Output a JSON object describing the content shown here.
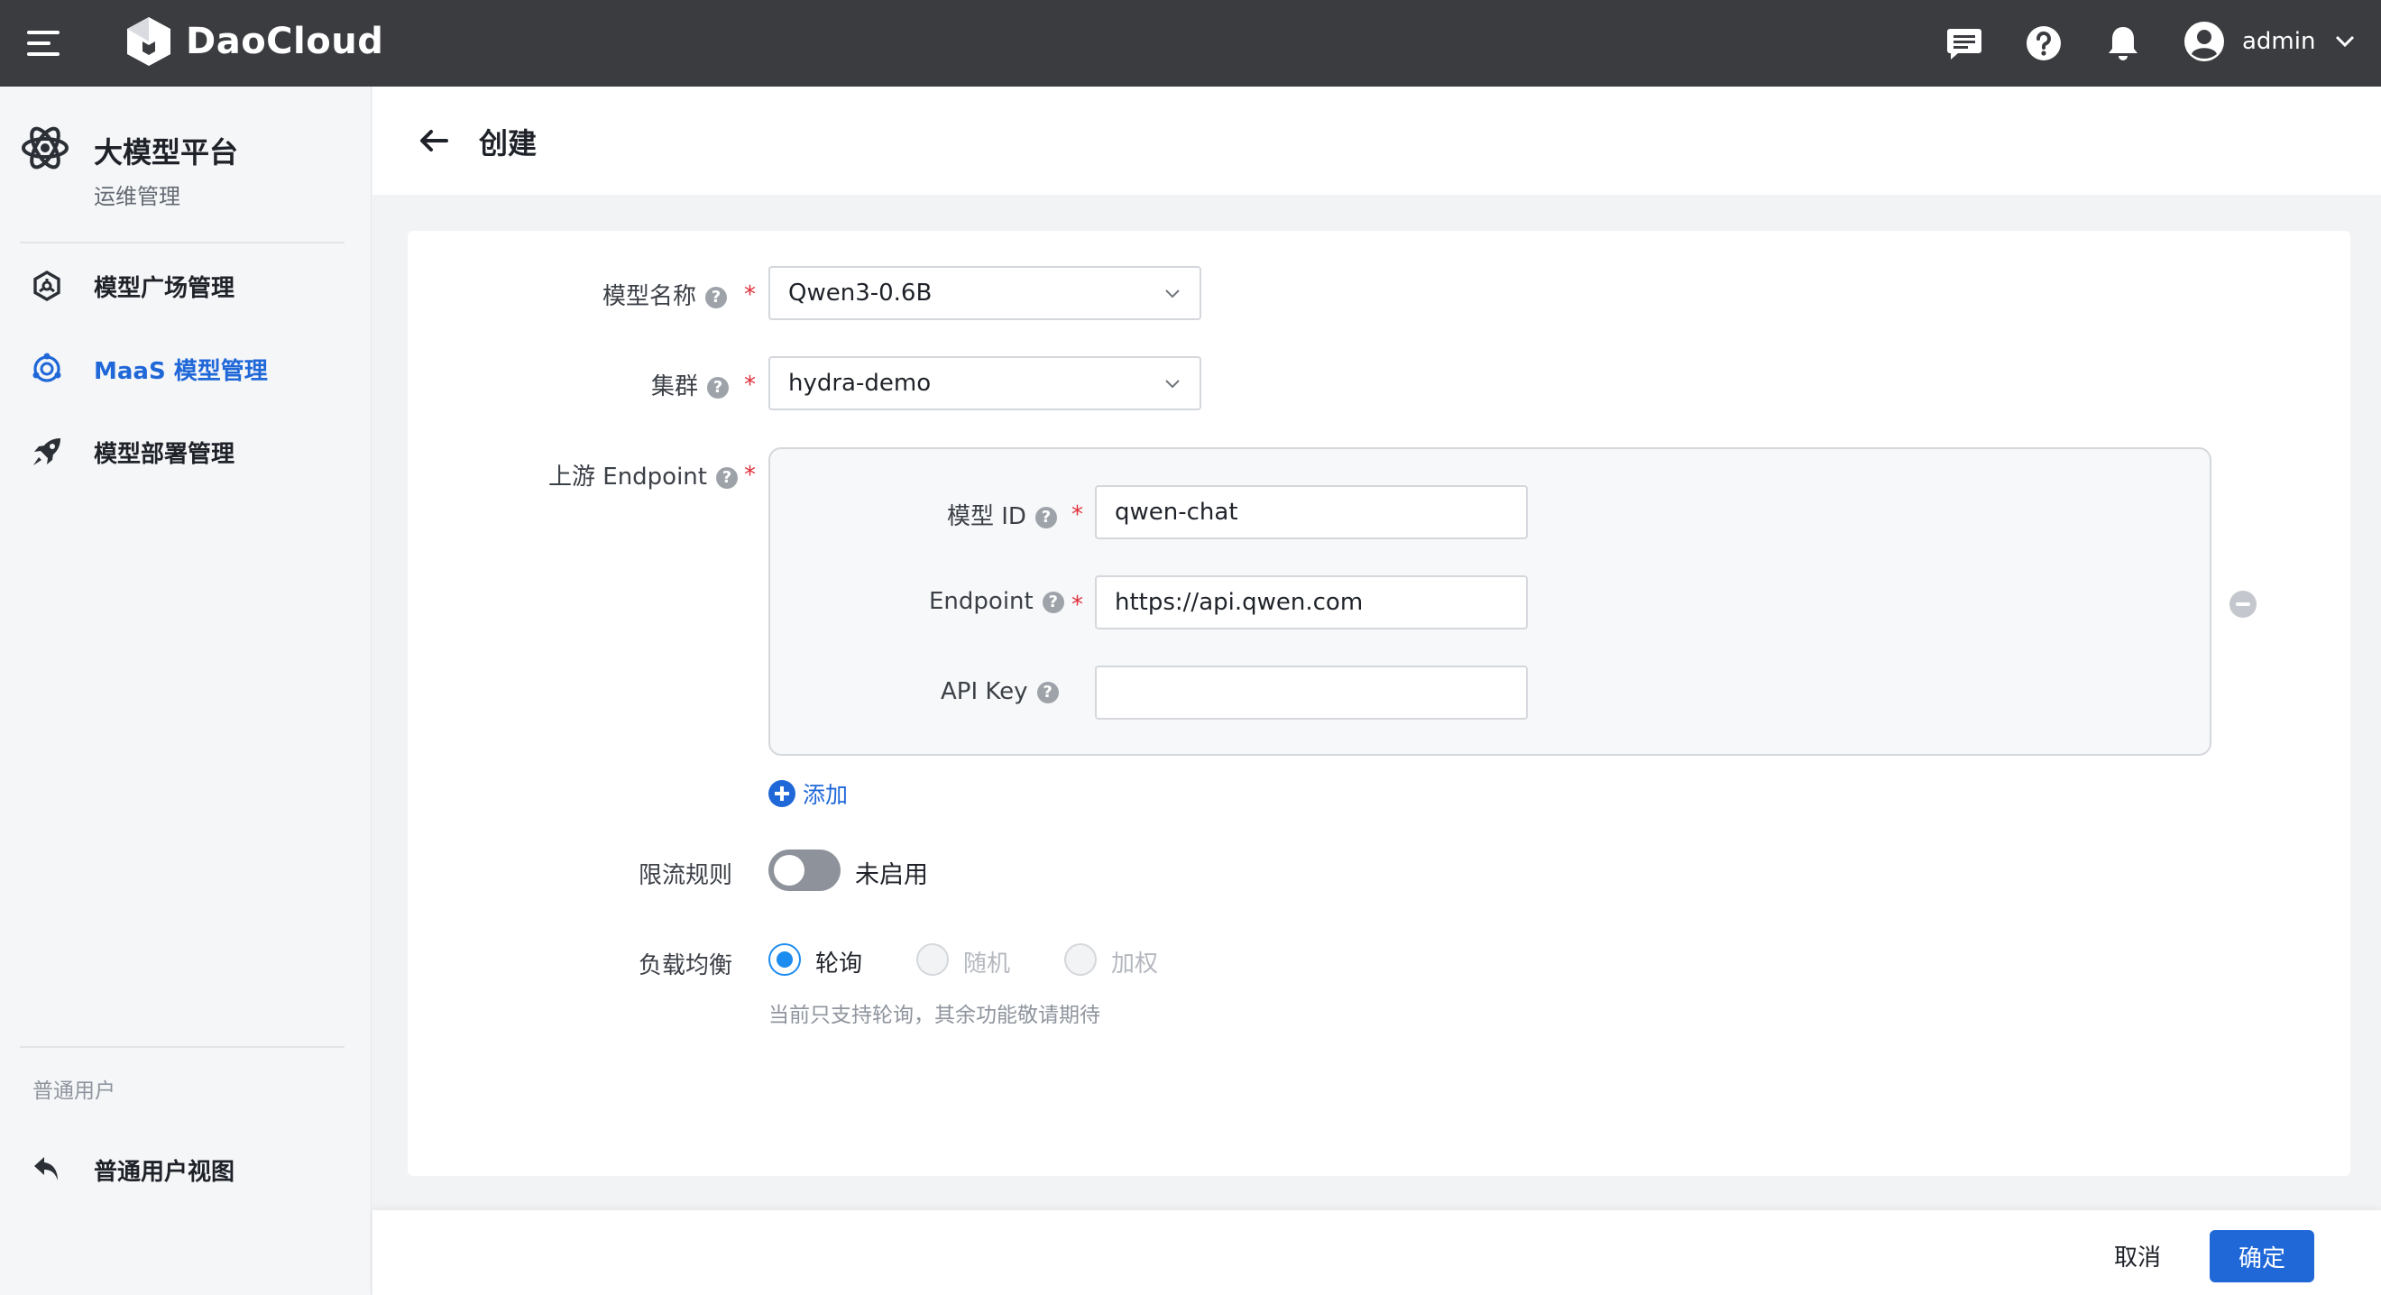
{
  "app": {
    "brand": "DaoCloud",
    "user": "admin",
    "colors": {
      "topbar": "#3a3c40",
      "accent": "#2068d8",
      "required": "#e0303b",
      "radio": "#1d8cf0"
    }
  },
  "topbar": {
    "icons": [
      "menu-icon",
      "daocloud-logo",
      "message-icon",
      "help-icon",
      "bell-icon",
      "user-avatar-icon",
      "chevron-down-icon"
    ]
  },
  "sidebar": {
    "platform_title": "大模型平台",
    "platform_subtitle": "运维管理",
    "items": [
      {
        "label": "模型广场管理",
        "icon": "model-plaza-icon",
        "active": false
      },
      {
        "label": "MaaS 模型管理",
        "icon": "maas-icon",
        "active": true
      },
      {
        "label": "模型部署管理",
        "icon": "rocket-icon",
        "active": false
      }
    ],
    "section_label": "普通用户",
    "user_view": {
      "label": "普通用户视图",
      "icon": "return-icon"
    }
  },
  "page": {
    "title": "创建"
  },
  "form": {
    "model_name": {
      "label": "模型名称",
      "value": "Qwen3-0.6B",
      "required": true
    },
    "cluster": {
      "label": "集群",
      "value": "hydra-demo",
      "required": true
    },
    "upstream": {
      "label": "上游 Endpoint",
      "required": true,
      "model_id": {
        "label": "模型 ID",
        "value": "qwen-chat",
        "required": true
      },
      "endpoint": {
        "label": "Endpoint",
        "value": "https://api.qwen.com",
        "required": true
      },
      "api_key": {
        "label": "API Key",
        "value": "",
        "required": false
      }
    },
    "add_label": "添加",
    "rate_limit": {
      "label": "限流规则",
      "status_text": "未启用",
      "enabled": false
    },
    "load_balance": {
      "label": "负载均衡",
      "options": [
        {
          "label": "轮询",
          "checked": true,
          "disabled": false
        },
        {
          "label": "随机",
          "checked": false,
          "disabled": true
        },
        {
          "label": "加权",
          "checked": false,
          "disabled": true
        }
      ],
      "hint": "当前只支持轮询，其余功能敬请期待"
    }
  },
  "footer": {
    "cancel_label": "取消",
    "confirm_label": "确定"
  }
}
